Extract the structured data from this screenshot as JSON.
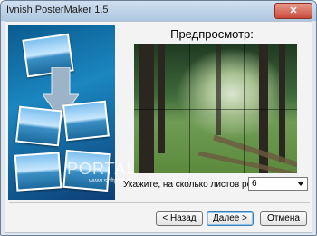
{
  "window": {
    "title": "Ivnish PosterMaker 1.5",
    "close_label": "✕"
  },
  "preview": {
    "title": "Предпросмотр:"
  },
  "sheets": {
    "prompt": "Укажите, на сколько листов резать:",
    "value": "6"
  },
  "watermark": {
    "text": "PORTAL",
    "sub": "www.softportal.com"
  },
  "buttons": {
    "back": "< Назад",
    "next": "Далее >",
    "cancel": "Отмена"
  }
}
